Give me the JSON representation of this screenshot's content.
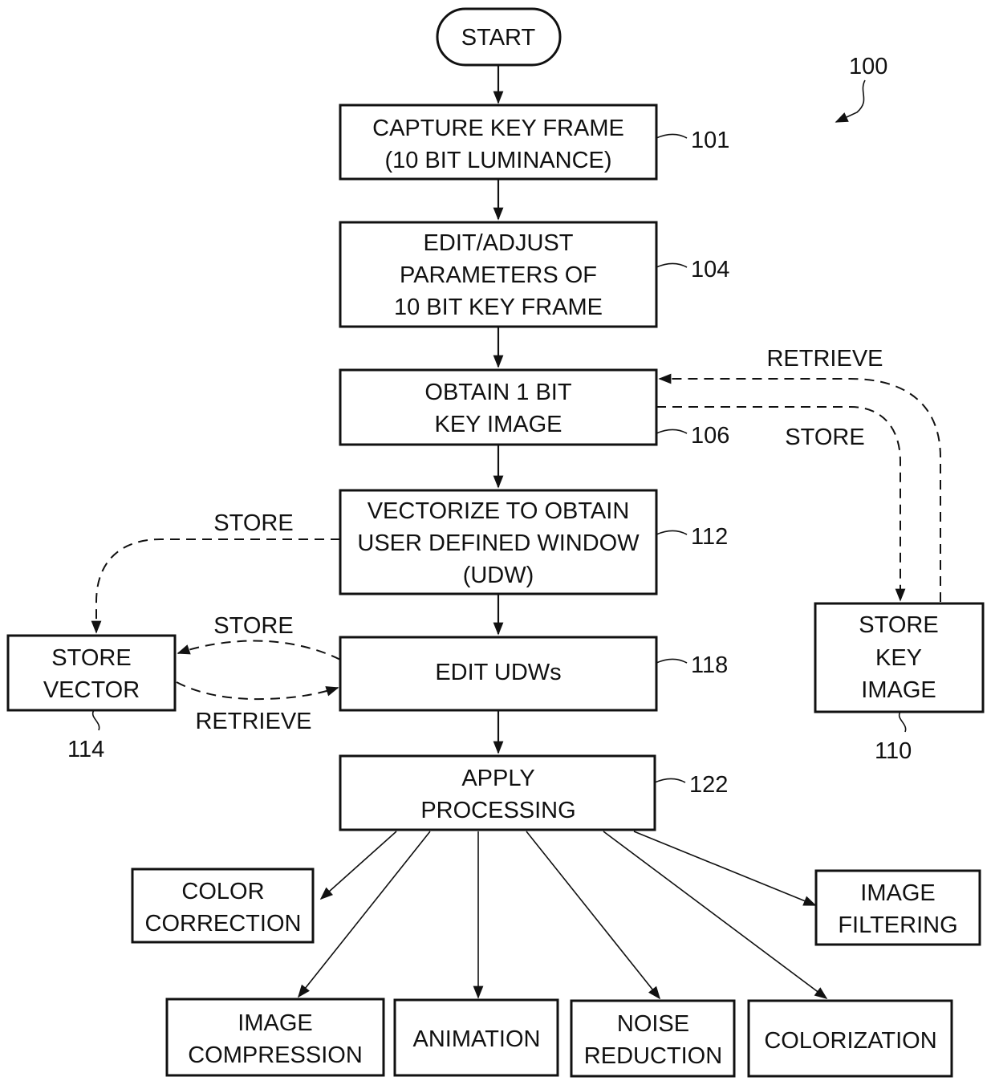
{
  "figure": {
    "ref_number": "100",
    "start": "START",
    "steps": {
      "s101": {
        "ref": "101",
        "lines": [
          "CAPTURE KEY FRAME",
          "(10 BIT LUMINANCE)"
        ]
      },
      "s104": {
        "ref": "104",
        "lines": [
          "EDIT/ADJUST",
          "PARAMETERS OF",
          "10 BIT KEY FRAME"
        ]
      },
      "s106": {
        "ref": "106",
        "lines": [
          "OBTAIN 1 BIT",
          "KEY IMAGE"
        ]
      },
      "s112": {
        "ref": "112",
        "lines": [
          "VECTORIZE TO OBTAIN",
          "USER DEFINED WINDOW",
          "(UDW)"
        ]
      },
      "s118": {
        "ref": "118",
        "lines": [
          "EDIT UDWs"
        ]
      },
      "s122": {
        "ref": "122",
        "lines": [
          "APPLY",
          "PROCESSING"
        ]
      },
      "s110": {
        "ref": "110",
        "lines": [
          "STORE",
          "KEY",
          "IMAGE"
        ]
      },
      "s114": {
        "ref": "114",
        "lines": [
          "STORE",
          "VECTOR"
        ]
      }
    },
    "edge_labels": {
      "retrieve_key_image": "RETRIEVE",
      "store_key_image": "STORE",
      "store_vector_from_112": "STORE",
      "store_vector_from_118": "STORE",
      "retrieve_vector": "RETRIEVE"
    },
    "outputs": {
      "color_correction": [
        "COLOR",
        "CORRECTION"
      ],
      "image_filtering": [
        "IMAGE",
        "FILTERING"
      ],
      "image_compression": [
        "IMAGE",
        "COMPRESSION"
      ],
      "animation": [
        "ANIMATION"
      ],
      "noise_reduction": [
        "NOISE",
        "REDUCTION"
      ],
      "colorization": [
        "COLORIZATION"
      ]
    }
  }
}
